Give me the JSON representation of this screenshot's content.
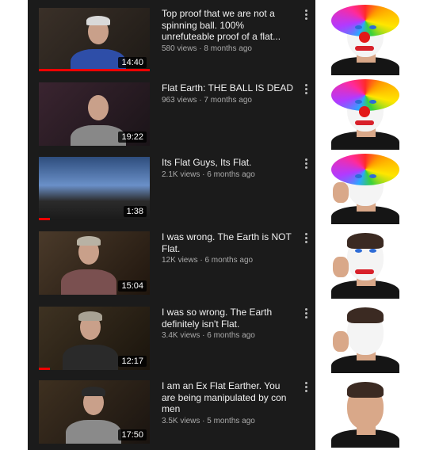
{
  "videos": [
    {
      "title": "Top proof that we are not a spinning ball. 100% unrefuteable proof of a flat...",
      "views": "580 views",
      "age": "8 months ago",
      "duration": "14:40",
      "progress": 1.0
    },
    {
      "title": "Flat Earth: THE BALL IS DEAD",
      "views": "963 views",
      "age": "7 months ago",
      "duration": "19:22",
      "progress": 0.0
    },
    {
      "title": "Its Flat Guys, Its Flat.",
      "views": "2.1K views",
      "age": "6 months ago",
      "duration": "1:38",
      "progress": 0.1
    },
    {
      "title": "I was wrong. The Earth is NOT Flat.",
      "views": "12K views",
      "age": "6 months ago",
      "duration": "15:04",
      "progress": 0.0
    },
    {
      "title": "I was so wrong. The Earth definitely isn't Flat.",
      "views": "3.4K views",
      "age": "6 months ago",
      "duration": "12:17",
      "progress": 0.1
    },
    {
      "title": "I am an Ex Flat Earther. You are being manipulated by con men",
      "views": "3.5K views",
      "age": "5 months ago",
      "duration": "17:50",
      "progress": 0.0
    }
  ],
  "separator": " · ",
  "menu_icon": "vertical-ellipsis-icon",
  "colors": {
    "list_bg": "#1b1b1b",
    "progress": "#ee0000",
    "title": "#f1f1f1",
    "subtitle": "#aaaaaa"
  }
}
